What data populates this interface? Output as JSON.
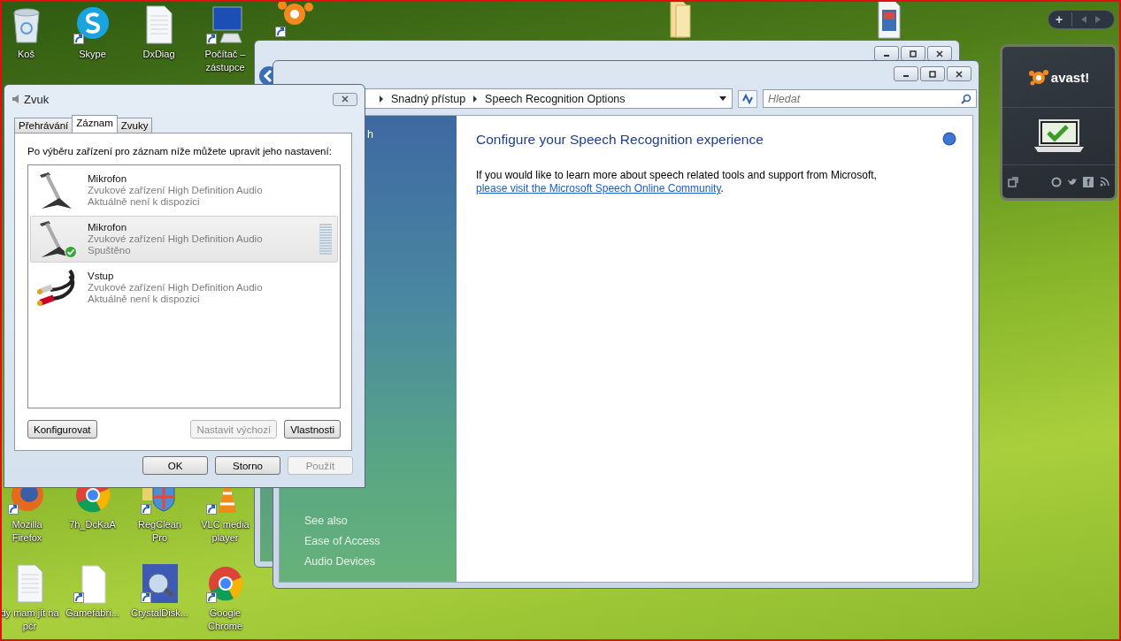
{
  "desktop_icons": [
    {
      "label": "Koš",
      "kind": "trash",
      "shortcut": false
    },
    {
      "label": "Skype",
      "kind": "skype",
      "shortcut": true
    },
    {
      "label": "DxDiag",
      "kind": "document",
      "shortcut": false
    },
    {
      "label": "Počítač – zástupce",
      "kind": "computer",
      "shortcut": true
    },
    {
      "kind": "avast",
      "shortcut": true
    },
    {
      "kind": "folder",
      "shortcut": false
    },
    {
      "kind": "video",
      "shortcut": false
    },
    {
      "label": "Mozilla Firefox",
      "kind": "firefox",
      "shortcut": true
    },
    {
      "label": "7h_DcKaA",
      "kind": "chrome",
      "shortcut": false
    },
    {
      "label": "RegClean Pro",
      "kind": "shield",
      "shortcut": true
    },
    {
      "label": "VLC media player",
      "kind": "cone",
      "shortcut": true
    },
    {
      "label": "dy mam jít na pčr",
      "kind": "document",
      "shortcut": false
    },
    {
      "label": "Gamefabri...",
      "kind": "blank",
      "shortcut": true
    },
    {
      "label": "CrystalDisk...",
      "kind": "disk",
      "shortcut": true
    },
    {
      "label": "Google Chrome",
      "kind": "chrome",
      "shortcut": true
    }
  ],
  "control_panel": {
    "breadcrumb": [
      "Snadný přístup",
      "Speech Recognition Options"
    ],
    "search": {
      "placeholder": "Hledat"
    },
    "sidebar": {
      "top_link": "h",
      "see_also": "See also",
      "links": [
        "Ease of Access",
        "Audio Devices"
      ]
    },
    "heading": "Configure your Speech Recognition experience",
    "text": "If you would like to learn more about speech related tools and support from Microsoft,",
    "link": "please visit the Microsoft Speech Online Community",
    "link_end": "."
  },
  "sound_dialog": {
    "title": "Zvuk",
    "tabs": [
      {
        "label": "Přehrávání",
        "selected": false
      },
      {
        "label": "Záznam",
        "selected": true
      },
      {
        "label": "Zvuky",
        "selected": false
      }
    ],
    "instruction": "Po výběru zařízení pro záznam níže můžete upravit jeho nastavení:",
    "devices": [
      {
        "kind": "microphone",
        "name": "Mikrofon",
        "description": "Zvukové zařízení High Definition Audio",
        "status": "Aktuálně není k dispozici",
        "selected": false,
        "default": false
      },
      {
        "kind": "microphone",
        "name": "Mikrofon",
        "description": "Zvukové zařízení High Definition Audio",
        "status": "Spuštěno",
        "selected": true,
        "default": true
      },
      {
        "kind": "line-in",
        "name": "Vstup",
        "description": "Zvukové zařízení High Definition Audio",
        "status": "Aktuálně není k dispozici",
        "selected": false,
        "default": false
      }
    ],
    "list_buttons": [
      {
        "label": "Konfigurovat",
        "disabled": false
      },
      {
        "label": "Nastavit výchozí",
        "disabled": true
      },
      {
        "label": "Vlastnosti",
        "disabled": false
      }
    ],
    "buttons": [
      {
        "label": "OK",
        "disabled": false
      },
      {
        "label": "Storno",
        "disabled": false
      },
      {
        "label": "Použít",
        "disabled": true
      }
    ]
  },
  "avast_gadget": {
    "add": "+",
    "logo": "avast!",
    "facebook": "f"
  }
}
